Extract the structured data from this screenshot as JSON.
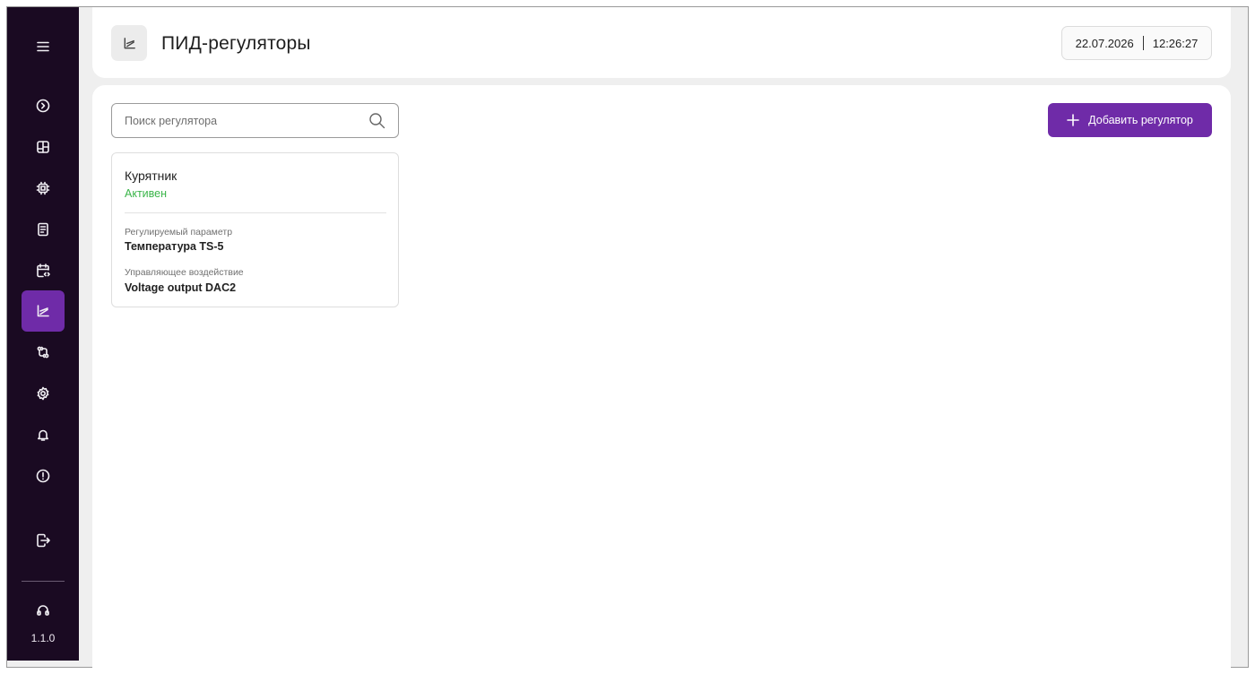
{
  "sidebar": {
    "items": [
      {
        "icon": "menu-icon"
      },
      {
        "icon": "chevron-right-circle-icon"
      },
      {
        "icon": "dashboard-icon"
      },
      {
        "icon": "chip-icon"
      },
      {
        "icon": "document-icon"
      },
      {
        "icon": "calendar-code-icon"
      },
      {
        "icon": "chart-line-icon",
        "active": true
      },
      {
        "icon": "swap-icon"
      },
      {
        "icon": "gear-icon"
      },
      {
        "icon": "bell-icon"
      },
      {
        "icon": "alert-circle-icon"
      },
      {
        "icon": "logout-icon"
      },
      {
        "icon": "headset-icon"
      }
    ],
    "version": "1.1.0",
    "accent_color": "#6f2ba8",
    "background_color": "#1a0a22"
  },
  "header": {
    "title": "ПИД-регуляторы",
    "icon": "chart-line-icon",
    "date": "22.07.2026",
    "time": "12:26:27"
  },
  "main": {
    "search": {
      "placeholder": "Поиск регулятора",
      "value": "",
      "icon": "search-icon"
    },
    "add_button": {
      "label": "Добавить регулятор",
      "icon": "plus-icon"
    },
    "cards": [
      {
        "name": "Курятник",
        "status": "Активен",
        "status_color": "#3bb54a",
        "param_label": "Регулируемый параметр",
        "param_value": "Температура TS-5",
        "control_label": "Управляющее воздействие",
        "control_value": "Voltage output DAC2"
      }
    ]
  }
}
